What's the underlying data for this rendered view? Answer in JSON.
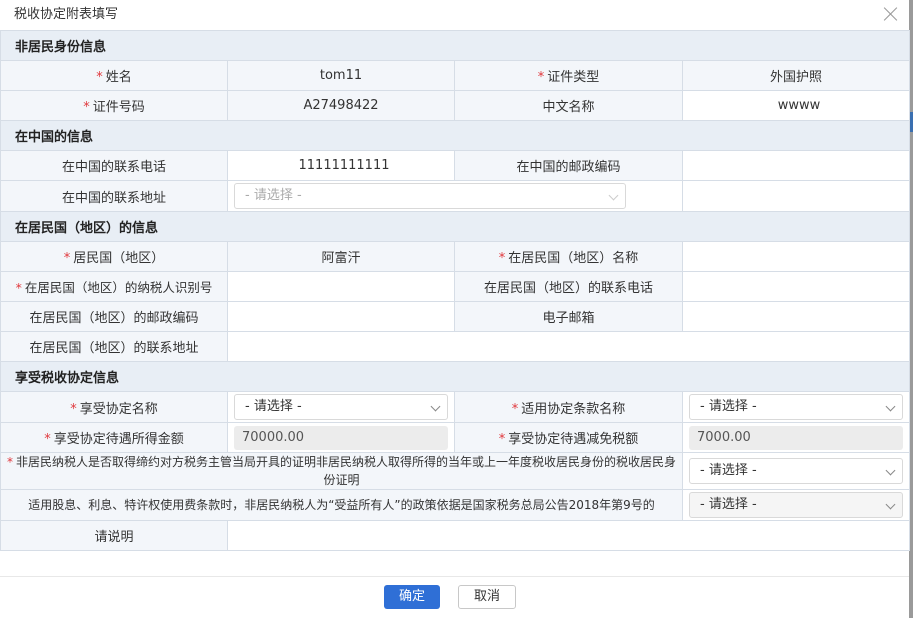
{
  "dialog": {
    "title": "税收协定附表填写"
  },
  "sections": {
    "identity": "非居民身份信息",
    "china": "在中国的信息",
    "residence": "在居民国（地区）的信息",
    "treaty": "享受税收协定信息"
  },
  "identity": {
    "name_label": "姓名",
    "name_value": "tom11",
    "idtype_label": "证件类型",
    "idtype_value": "外国护照",
    "idno_label": "证件号码",
    "idno_value": "A27498422",
    "cnname_label": "中文名称",
    "cnname_value": "wwww"
  },
  "china": {
    "phone_label": "在中国的联系电话",
    "phone_value": "11111111111",
    "postcode_label": "在中国的邮政编码",
    "postcode_value": "",
    "address_label": "在中国的联系地址",
    "address_placeholder": "- 请选择 -",
    "address_value": ""
  },
  "residence": {
    "country_label": "居民国（地区）",
    "country_value": "阿富汗",
    "countryname_label": "在居民国（地区）名称",
    "countryname_value": "",
    "taxid_label": "在居民国（地区）的纳税人识别号",
    "taxid_value": "",
    "phone_label": "在居民国（地区）的联系电话",
    "phone_value": "",
    "postcode_label": "在居民国（地区）的邮政编码",
    "postcode_value": "",
    "email_label": "电子邮箱",
    "email_value": "",
    "address_label": "在居民国（地区）的联系地址",
    "address_value": ""
  },
  "treaty": {
    "name_label": "享受协定名称",
    "name_select": "- 请选择 -",
    "clause_label": "适用协定条款名称",
    "clause_select": "- 请选择 -",
    "income_label": "享受协定待遇所得金额",
    "income_value": "70000.00",
    "reduction_label": "享受协定待遇减免税额",
    "reduction_value": "7000.00",
    "certificate_label": "非居民纳税人是否取得缔约对方税务主管当局开具的证明非居民纳税人取得所得的当年或上一年度税收居民身份的税收居民身份证明",
    "certificate_select": "- 请选择 -",
    "beneficial_label": "适用股息、利息、特许权使用费条款时，非居民纳税人为“受益所有人”的政策依据是国家税务总局公告2018年第9号的",
    "beneficial_select": "- 请选择 -",
    "explain_label": "请说明",
    "explain_value": ""
  },
  "buttons": {
    "ok": "确定",
    "cancel": "取消"
  }
}
